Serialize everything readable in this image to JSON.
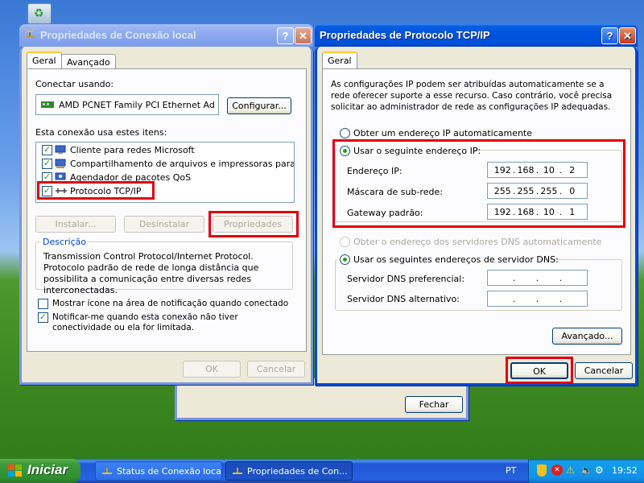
{
  "desktop": {
    "recycle_icon": "recycle-bin-icon"
  },
  "conn_props": {
    "title": "Propriedades de Conexão local",
    "tabs": [
      "Geral",
      "Avançado"
    ],
    "connect_using_label": "Conectar usando:",
    "adapter": "AMD PCNET Family PCI Ethernet Ad",
    "configure_btn": "Configurar...",
    "items_label": "Esta conexão usa estes itens:",
    "items": [
      {
        "label": "Cliente para redes Microsoft",
        "checked": true
      },
      {
        "label": "Compartilhamento de arquivos e impressoras para redes...",
        "checked": true
      },
      {
        "label": "Agendador de pacotes QoS",
        "checked": true
      },
      {
        "label": "Protocolo TCP/IP",
        "checked": true
      }
    ],
    "install_btn": "Instalar...",
    "uninstall_btn": "Desinstalar",
    "properties_btn": "Propriedades",
    "description_label": "Descrição",
    "description_text": "Transmission Control Protocol/Internet Protocol. Protocolo padrão de rede de longa distância que possibilita a comunicação entre diversas redes interconectadas.",
    "show_icon_label": "Mostrar ícone na área de notificação quando conectado",
    "show_icon_checked": false,
    "notify_label": "Notificar-me quando esta conexão não tiver conectividade ou ela for limitada.",
    "notify_checked": true,
    "ok_btn": "OK",
    "cancel_btn": "Cancelar"
  },
  "status_window": {
    "close_btn": "Fechar"
  },
  "tcpip": {
    "title": "Propriedades de Protocolo TCP/IP",
    "tab": "Geral",
    "intro": "As configurações IP podem ser atribuídas automaticamente se a rede oferecer suporte a esse recurso. Caso contrário, você precisa solicitar ao administrador de rede as configurações IP adequadas.",
    "auto_ip_label": "Obter um endereço IP automaticamente",
    "manual_ip_label": "Usar o seguinte endereço IP:",
    "ip_label": "Endereço IP:",
    "ip_value": [
      "192",
      "168",
      "10",
      "2"
    ],
    "mask_label": "Máscara de sub-rede:",
    "mask_value": [
      "255",
      "255",
      "255",
      "0"
    ],
    "gateway_label": "Gateway padrão:",
    "gateway_value": [
      "192",
      "168",
      "10",
      "1"
    ],
    "auto_dns_label": "Obter o endereço dos servidores DNS automaticamente",
    "manual_dns_label": "Usar os seguintes endereços de servidor DNS:",
    "dns_pref_label": "Servidor DNS preferencial:",
    "dns_alt_label": "Servidor DNS alternativo:",
    "advanced_btn": "Avançado...",
    "ok_btn": "OK",
    "cancel_btn": "Cancelar"
  },
  "taskbar": {
    "start_label": "Iniciar",
    "tasks": [
      "Status de Conexão local",
      "Propriedades de Con..."
    ],
    "lang": "PT",
    "clock": "19:52"
  }
}
